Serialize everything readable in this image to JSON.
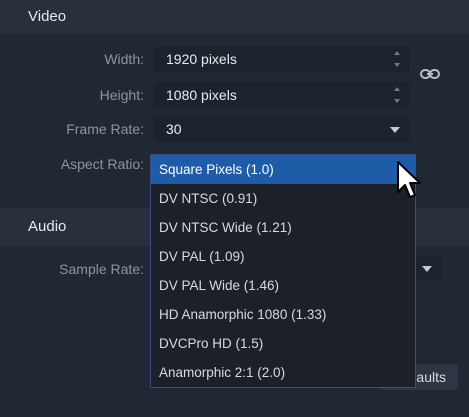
{
  "video": {
    "title": "Video",
    "width": {
      "label": "Width:",
      "value": "1920 pixels"
    },
    "height": {
      "label": "Height:",
      "value": "1080 pixels"
    },
    "frame_rate": {
      "label": "Frame Rate:",
      "value": "30"
    },
    "aspect_ratio": {
      "label": "Aspect Ratio:",
      "selected": "Square Pixels (1.0)",
      "options": [
        "Square Pixels (1.0)",
        "DV NTSC (0.91)",
        "DV NTSC Wide (1.21)",
        "DV PAL (1.09)",
        "DV PAL Wide (1.46)",
        "HD Anamorphic 1080 (1.33)",
        "DVCPro HD (1.5)",
        "Anamorphic 2:1 (2.0)"
      ]
    }
  },
  "audio": {
    "title": "Audio",
    "sample_rate": {
      "label": "Sample Rate:"
    }
  },
  "buttons": {
    "defaults_label": "aults"
  },
  "icons": {
    "link": "link-icon",
    "cursor": "mouse-pointer-icon"
  }
}
